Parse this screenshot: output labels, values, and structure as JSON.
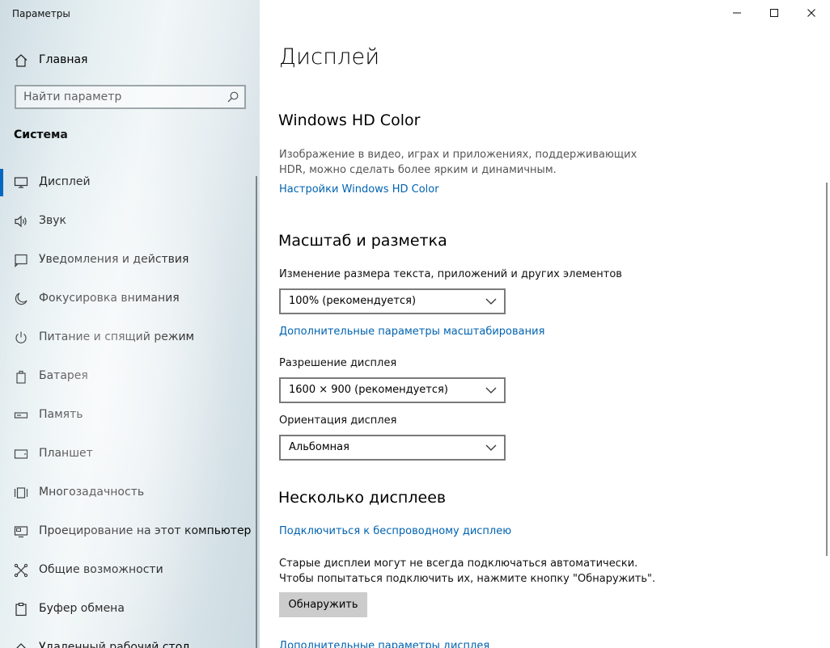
{
  "window": {
    "title": "Параметры",
    "minimize": "minimize",
    "maximize": "maximize",
    "close": "close"
  },
  "sidebar": {
    "home_label": "Главная",
    "search_placeholder": "Найти параметр",
    "section": "Система",
    "items": [
      {
        "label": "Дисплей",
        "icon": "monitor-icon",
        "active": true
      },
      {
        "label": "Звук",
        "icon": "speaker-icon"
      },
      {
        "label": "Уведомления и действия",
        "icon": "notification-icon"
      },
      {
        "label": "Фокусировка внимания",
        "icon": "moon-icon"
      },
      {
        "label": "Питание и спящий режим",
        "icon": "power-icon"
      },
      {
        "label": "Батарея",
        "icon": "battery-icon"
      },
      {
        "label": "Память",
        "icon": "storage-icon"
      },
      {
        "label": "Планшет",
        "icon": "tablet-icon"
      },
      {
        "label": "Многозадачность",
        "icon": "multitasking-icon"
      },
      {
        "label": "Проецирование на этот компьютер",
        "icon": "projecting-icon"
      },
      {
        "label": "Общие возможности",
        "icon": "shared-experiences-icon"
      },
      {
        "label": "Буфер обмена",
        "icon": "clipboard-icon"
      },
      {
        "label": "Удаленный рабочий стол",
        "icon": "remote-desktop-icon"
      }
    ]
  },
  "main": {
    "title": "Дисплей",
    "hdr": {
      "heading": "Windows HD Color",
      "desc_line1": "Изображение в видео, играх и приложениях, поддерживающих",
      "desc_line2": "HDR, можно сделать более ярким и динамичным.",
      "link": "Настройки Windows HD Color"
    },
    "scale": {
      "heading": "Масштаб и разметка",
      "size_label": "Изменение размера текста, приложений и других элементов",
      "size_value": "100% (рекомендуется)",
      "advanced_link": "Дополнительные параметры масштабирования",
      "resolution_label": "Разрешение дисплея",
      "resolution_value": "1600 × 900 (рекомендуется)",
      "orientation_label": "Ориентация дисплея",
      "orientation_value": "Альбомная"
    },
    "multi": {
      "heading": "Несколько дисплеев",
      "wireless_link": "Подключиться к беспроводному дисплею",
      "desc_line1": "Старые дисплеи могут не всегда подключаться автоматически.",
      "desc_line2": "Чтобы попытаться подключить их, нажмите кнопку \"Обнаружить\".",
      "detect_button": "Обнаружить",
      "advanced_display_link": "Дополнительные параметры дисплея"
    }
  },
  "colors": {
    "accent": "#0067c0",
    "link": "#0063b1"
  }
}
